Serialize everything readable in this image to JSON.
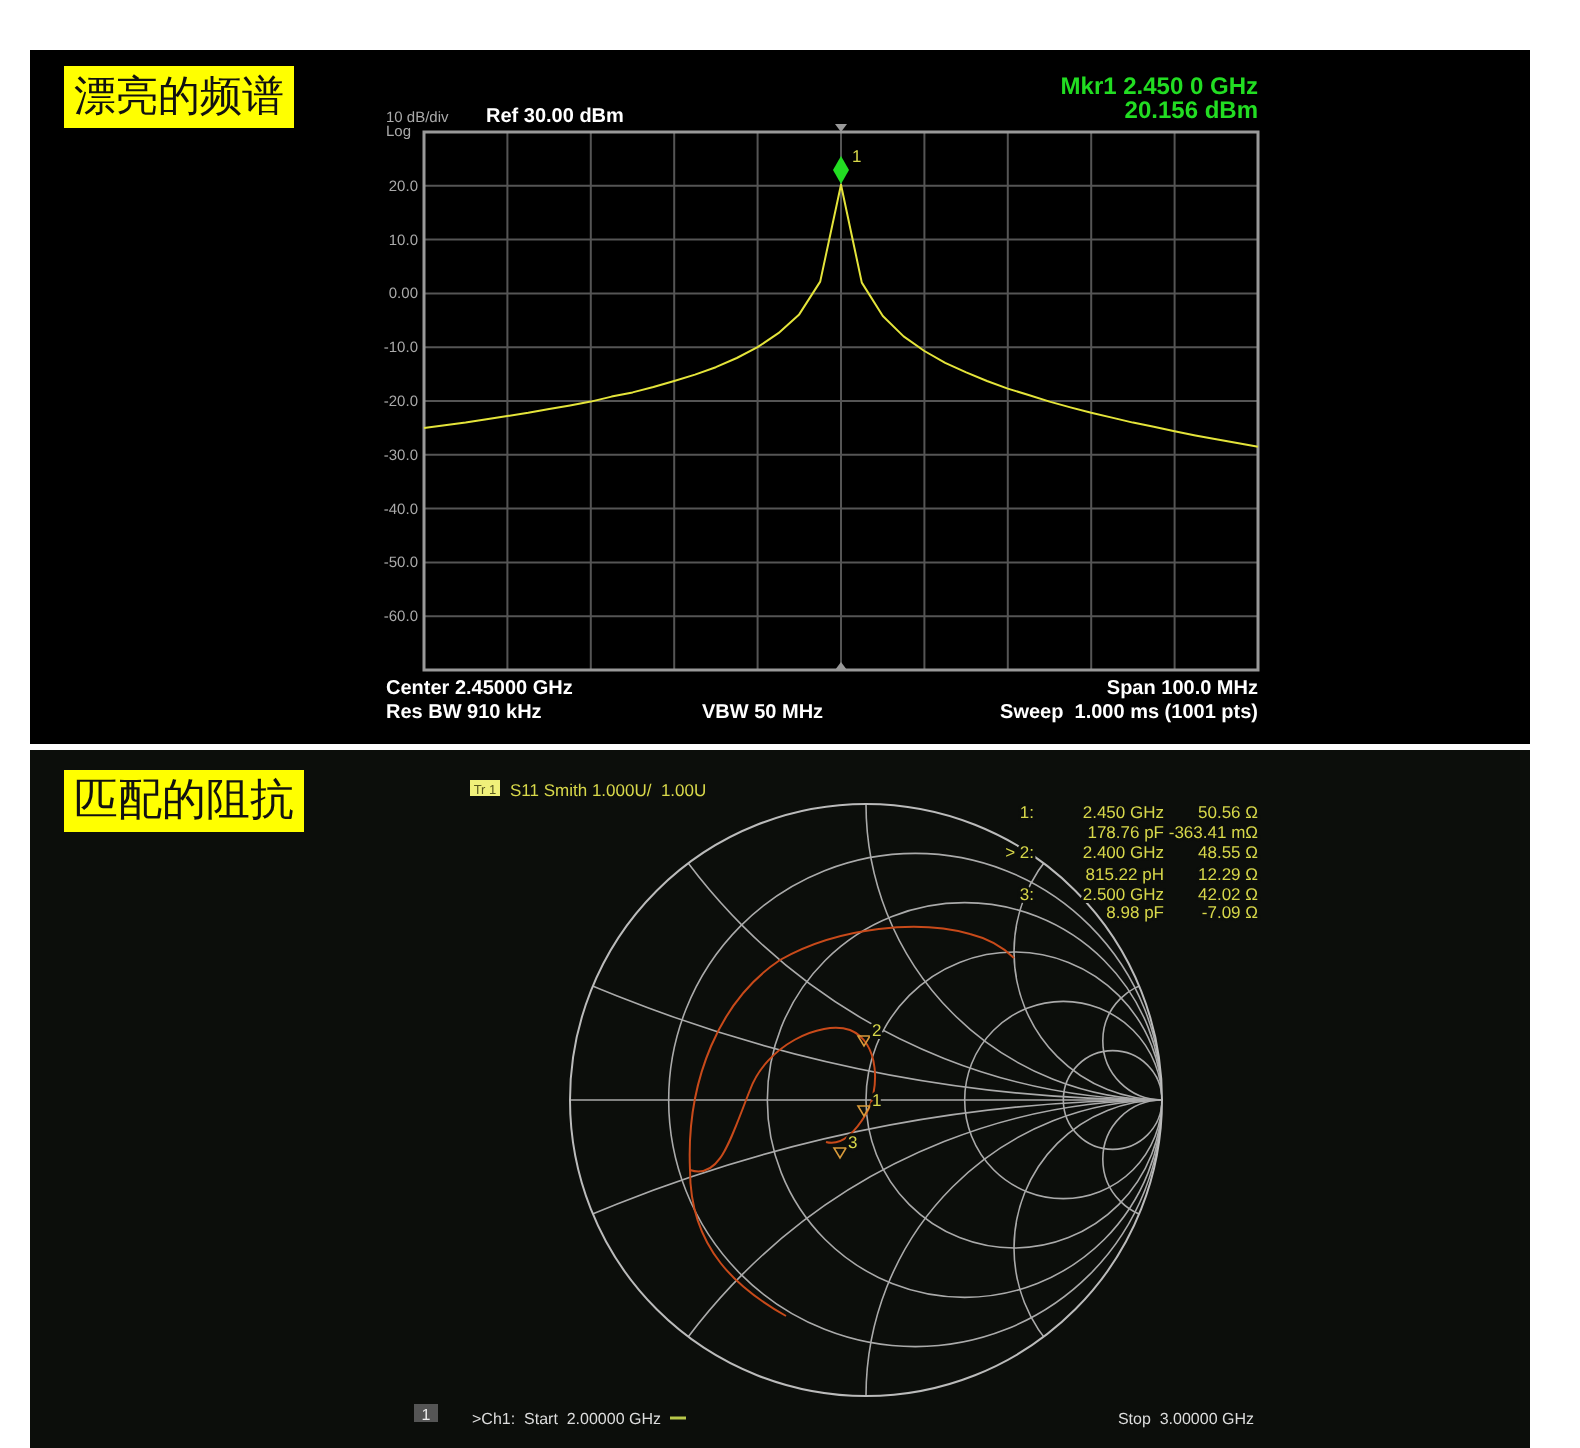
{
  "spectrum_panel": {
    "title": "漂亮的频谱",
    "scale": "10 dB/div",
    "scale_type": "Log",
    "reference": "Ref 30.00 dBm",
    "marker_readout": [
      "Mkr1 2.450 0 GHz",
      "20.156 dBm"
    ],
    "marker_label": "1",
    "chart_data": {
      "type": "line",
      "categories": [
        null,
        null,
        null,
        null,
        null,
        null,
        null,
        null,
        null,
        null,
        null,
        null,
        null,
        null,
        null,
        null,
        null,
        null,
        null,
        null,
        null,
        null,
        null,
        null,
        null,
        null,
        null,
        null,
        null,
        null,
        null,
        null,
        null,
        null,
        null,
        null,
        null,
        null,
        null,
        null,
        null
      ],
      "series": [
        {
          "color": "#e4e43a",
          "values": [
            -25.0,
            -24.5,
            -24.0,
            -23.4,
            -22.8,
            -22.2,
            -21.5,
            -20.8,
            -20.1,
            -19.2,
            -18.4,
            -17.4,
            -16.3,
            -15.1,
            -13.7,
            -12.0,
            -10.0,
            -7.4,
            -3.9,
            2.2,
            20.2,
            2.0,
            -4.2,
            -8.0,
            -10.7,
            -12.9,
            -14.7,
            -16.3,
            -17.7,
            -18.9,
            -20.1,
            -21.2,
            -22.2,
            -23.1,
            -24.0,
            -24.8,
            -25.6,
            -26.4,
            -27.1,
            -27.8,
            -28.5
          ]
        }
      ],
      "ylim": [
        -70,
        30
      ],
      "grid": true,
      "yticks": [
        {
          "value": 20,
          "label": "20.0"
        },
        {
          "value": 10,
          "label": "10.0"
        },
        {
          "value": 0,
          "label": "0.00"
        },
        {
          "value": -10,
          "label": "-10.0"
        },
        {
          "value": -20,
          "label": "-20.0"
        },
        {
          "value": -30,
          "label": "-30.0"
        },
        {
          "value": -40,
          "label": "-40.0"
        },
        {
          "value": -50,
          "label": "-50.0"
        },
        {
          "value": -60,
          "label": "-60.0"
        }
      ]
    },
    "center": "Center 2.45000 GHz",
    "res_bw": "Res BW 910 kHz",
    "vbw": "VBW 50 MHz",
    "span": "Span 100.0 MHz",
    "sweep": "Sweep  1.000 ms (1001 pts)"
  },
  "smith_panel": {
    "title": "匹配的阻抗",
    "trace_swatch": "Tr 1",
    "trace_label": "S11 Smith 1.000U/  1.00U",
    "marker_table": [
      {
        "marker": "1:",
        "value_1": "2.450 GHz",
        "value_2": "50.56 Ω"
      },
      {
        "value_1": "178.76 pF",
        "value_2": "-363.41 mΩ"
      },
      {
        "marker": "> 2:",
        "value_1": "2.400 GHz",
        "value_2": "48.55 Ω"
      },
      {
        "value_1": "815.22 pH",
        "value_2": "12.29 Ω"
      },
      {
        "marker": "3:",
        "value_1": "2.500 GHz",
        "value_2": "42.02 Ω"
      },
      {
        "value_1": "8.98 pF",
        "value_2": "-7.09 Ω"
      }
    ],
    "trace_markers": [
      "2",
      "1",
      "3"
    ],
    "channel_number": "1",
    "start": ">Ch1:  Start  2.00000 GHz",
    "stop": "Stop  3.00000 GHz"
  }
}
